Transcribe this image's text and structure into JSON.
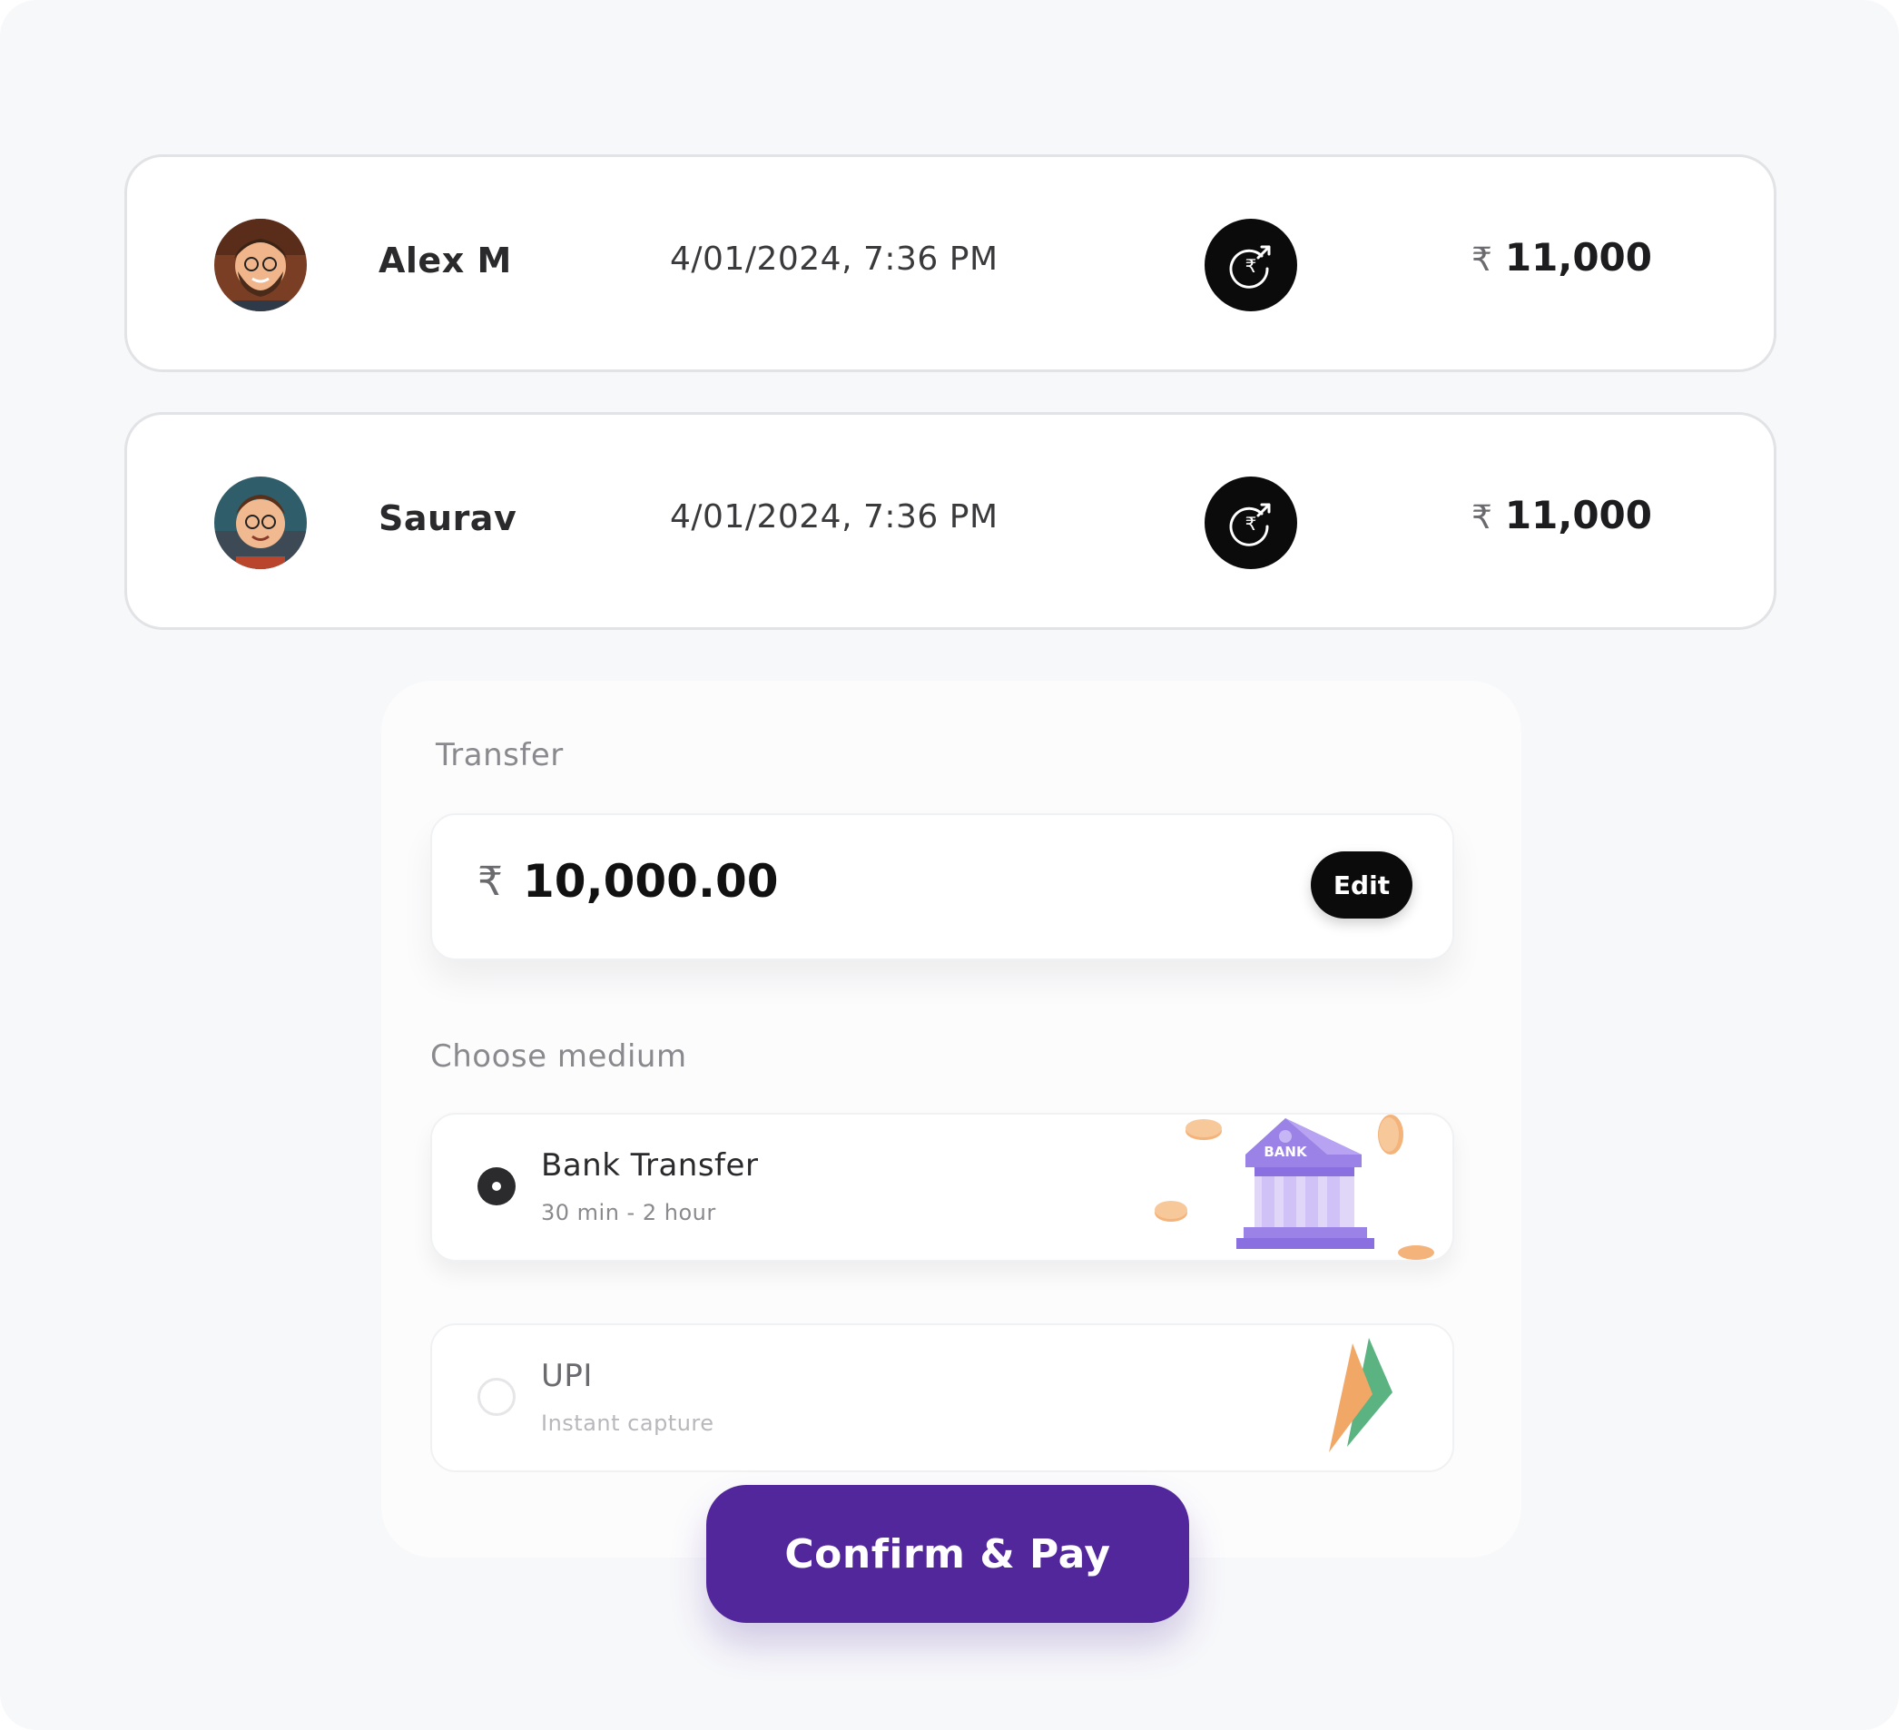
{
  "transactions": [
    {
      "name": "Alex M",
      "datetime": "4/01/2024, 7:36 PM",
      "currency": "₹",
      "amount": "11,000",
      "icon": "rupee-transfer-icon"
    },
    {
      "name": "Saurav",
      "datetime": "4/01/2024, 7:36 PM",
      "currency": "₹",
      "amount": "11,000",
      "icon": "rupee-transfer-icon"
    }
  ],
  "transfer": {
    "title": "Transfer",
    "currency": "₹",
    "amount": "10,000.00",
    "edit_label": "Edit"
  },
  "medium": {
    "label": "Choose medium",
    "options": [
      {
        "title": "Bank Transfer",
        "subtitle": "30 min - 2 hour",
        "selected": true,
        "illustration": "bank-icon",
        "illustration_text": "BANK"
      },
      {
        "title": "UPI",
        "subtitle": "Instant capture",
        "selected": false,
        "illustration": "upi-logo"
      }
    ]
  },
  "confirm_label": "Confirm & Pay",
  "colors": {
    "accent": "#51279b",
    "dark": "#0b0b0c",
    "background": "#f7f8fa"
  }
}
